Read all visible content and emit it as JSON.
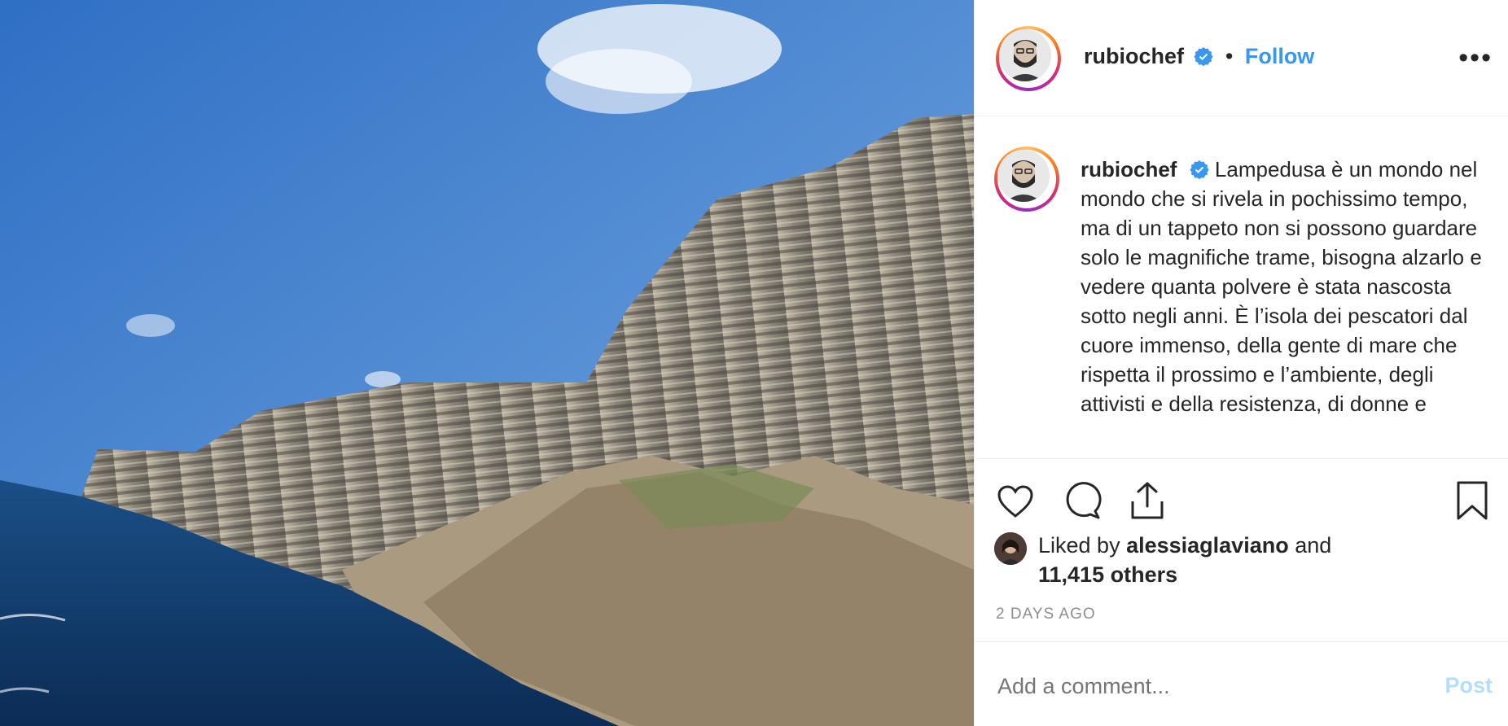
{
  "post": {
    "username": "rubiochef",
    "verified_icon": "verified-badge-icon",
    "separator": "•",
    "follow_label": "Follow",
    "more_label": "•••",
    "caption": "Lampedusa è un mondo nel mondo che si rivela in pochissimo tempo, ma di un tappeto non si possono guardare solo le magnifiche trame, bisogna alzarlo e vedere quanta polvere è stata nascosta sotto negli anni. È l’isola dei pescatori dal cuore immenso, della gente di mare che rispetta il prossimo e l’ambiente, degli attivisti e della resistenza, di donne e",
    "likes": {
      "prefix": "Liked by ",
      "user": "alessiaglaviano",
      "middle": " and",
      "others": "11,415 others"
    },
    "timestamp": "2 DAYS AGO",
    "comment_placeholder": "Add a comment...",
    "post_label": "Post"
  },
  "colors": {
    "accent": "#3897f0",
    "text": "#262626",
    "muted": "#8e8e8e",
    "post_disabled": "#b2dffc"
  },
  "icons": [
    "heart-icon",
    "comment-icon",
    "share-icon",
    "bookmark-icon",
    "more-options-icon",
    "verified-badge-icon"
  ]
}
